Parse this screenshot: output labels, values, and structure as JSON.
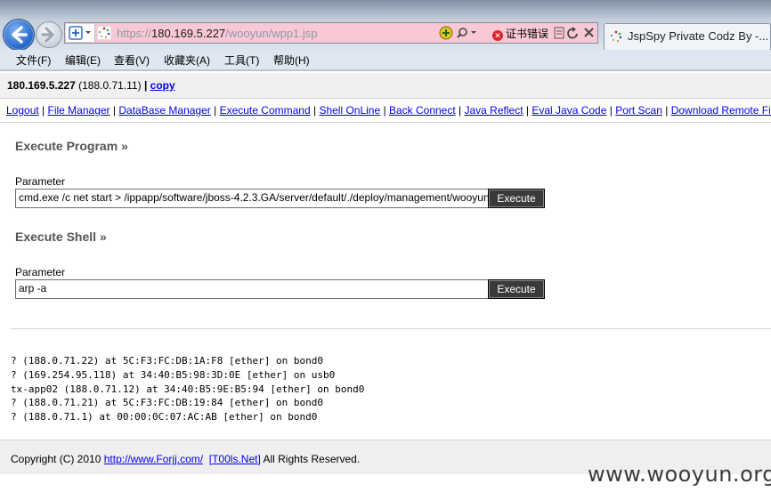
{
  "browser": {
    "url_prefix": "https://",
    "url_host": "180.169.5.227",
    "url_path": "/wooyun/wpp1.jsp",
    "cert_error": "证书错误",
    "tab_title": "JspSpy Private Codz By -..."
  },
  "menu": [
    "文件(F)",
    "编辑(E)",
    "查看(V)",
    "收藏夹(A)",
    "工具(T)",
    "帮助(H)"
  ],
  "hostbar": {
    "host": "180.169.5.227",
    "internal_ip": "(188.0.71.11)",
    "sep": "|",
    "copy_label": "copy"
  },
  "nav_links": [
    "Logout",
    "File Manager",
    "DataBase Manager",
    "Execute Command",
    "Shell OnLine",
    "Back Connect",
    "Java Reflect",
    "Eval Java Code",
    "Port Scan",
    "Download Remote File"
  ],
  "execute_program": {
    "title": "Execute Program",
    "raquo": "»",
    "param_label": "Parameter",
    "param_value": "cmd.exe /c net start > /ippapp/software/jboss-4.2.3.GA/server/default/./deploy/management/wooyun",
    "button_label": "Execute"
  },
  "execute_shell": {
    "title": "Execute Shell",
    "raquo": "»",
    "param_label": "Parameter",
    "param_value": "arp -a",
    "button_label": "Execute"
  },
  "output_lines": [
    "? (188.0.71.22) at 5C:F3:FC:DB:1A:F8 [ether] on bond0",
    "? (169.254.95.118) at 34:40:B5:98:3D:0E [ether] on usb0",
    "tx-app02 (188.0.71.12) at 34:40:B5:9E:B5:94 [ether] on bond0",
    "? (188.0.71.21) at 5C:F3:FC:DB:19:84 [ether] on bond0",
    "? (188.0.71.1) at 00:00:0C:07:AC:AB [ether] on bond0"
  ],
  "footer": {
    "prefix": "Copyright (C) 2010",
    "link1": "http://www.Forjj.com/",
    "link2": "[T00ls.Net]",
    "suffix": "All Rights Reserved."
  },
  "watermark": "www.wooyun.org"
}
